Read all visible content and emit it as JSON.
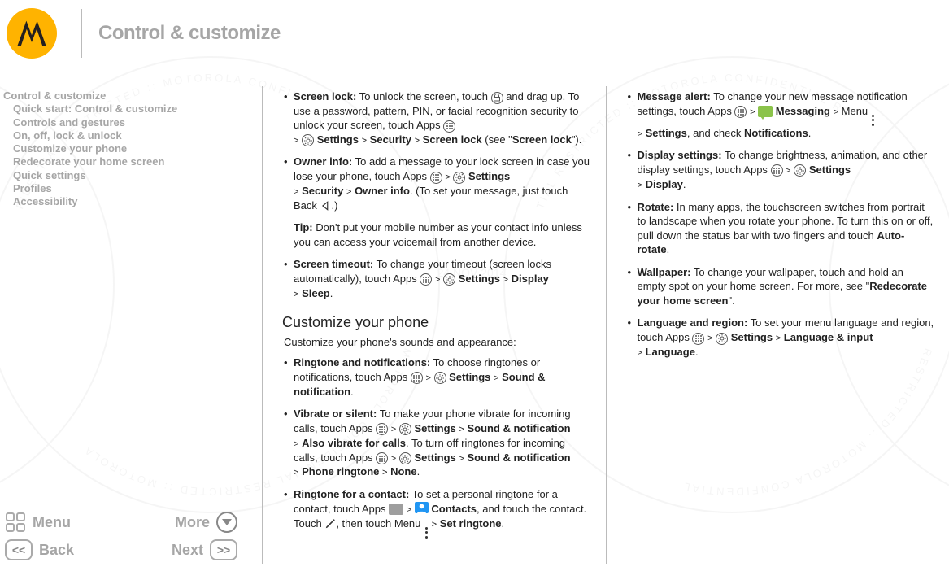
{
  "header": {
    "title": "Control & customize"
  },
  "toc": [
    {
      "label": "Control & customize",
      "lvl": 0
    },
    {
      "label": "Quick start: Control & customize",
      "lvl": 1
    },
    {
      "label": "Controls and gestures",
      "lvl": 1
    },
    {
      "label": "On, off, lock & unlock",
      "lvl": 1
    },
    {
      "label": "Customize your phone",
      "lvl": 1
    },
    {
      "label": "Redecorate your home screen",
      "lvl": 1
    },
    {
      "label": "Quick settings",
      "lvl": 1
    },
    {
      "label": "Profiles",
      "lvl": 1
    },
    {
      "label": "Accessibility",
      "lvl": 1
    }
  ],
  "nav": {
    "menu": "Menu",
    "more": "More",
    "back": "Back",
    "next": "Next"
  },
  "col1": {
    "screen_lock_b": "Screen lock:",
    "screen_lock_1": " To unlock the screen, touch ",
    "screen_lock_2": " and drag up. To use a password, pattern, PIN, or facial recognition security to unlock your screen, touch Apps ",
    "arrow": ">",
    "settings_b": "Settings",
    "security_b": "Security",
    "screenlock_b2": "Screen lock",
    "screen_lock_see": " (see \"",
    "screen_lock_link": "Screen lock",
    "screen_lock_end": "\").",
    "owner_b": "Owner info:",
    "owner_1": " To add a message to your lock screen in case you lose your phone, touch Apps ",
    "owner_info_b": "Owner info",
    "owner_2": ". (To set your message, just touch Back ",
    "owner_3": ".)",
    "tip_b": "Tip:",
    "tip_1": " Don't put your mobile number as your contact info unless you can access your voicemail from another device.",
    "timeout_b": "Screen timeout:",
    "timeout_1": " To change your timeout (screen locks automatically), touch Apps ",
    "display_b": "Display",
    "sleep_b": "Sleep",
    "h2": "Customize your phone",
    "intro": "Customize your phone's sounds and appearance:",
    "ring_b": "Ringtone and notifications:",
    "ring_1": " To choose ringtones or notifications, touch Apps ",
    "sound_b": "Sound & notification",
    "vibrate_b": "Vibrate or silent:",
    "vibrate_1": " To make your phone vibrate for incoming calls, touch Apps ",
    "also_vibrate_b": "Also vibrate for calls",
    "vibrate_2": ". To turn off ringtones for incoming calls, touch Apps ",
    "phone_ring_b": "Phone ringtone",
    "none_b": "None",
    "contact_b": "Ringtone for a contact:",
    "contact_1": " To set a personal ringtone for a contact, touch Apps ",
    "contacts_b2": "Contacts",
    "contact_2": ", and touch the contact. Touch ",
    "contact_3": ", then touch Menu ",
    "set_ring_b": "Set ringtone"
  },
  "col2": {
    "msg_b": "Message alert:",
    "msg_1": " To change your new message notification settings, touch Apps ",
    "messaging_b": "Messaging",
    "msg_2": " Menu ",
    "notifications_b": "Notifications",
    "check": ", and check ",
    "disp_b": "Display settings:",
    "disp_1": " To change brightness, animation, and other display settings, touch Apps ",
    "display_b": "Display",
    "rotate_b": "Rotate:",
    "rotate_1": " In many apps, the touchscreen switches from portrait to landscape when you rotate your phone. To turn this on or off, pull down the status bar with two fingers and touch ",
    "auto_rotate_b": "Auto-rotate",
    "wall_b": "Wallpaper:",
    "wall_1": " To change your wallpaper, touch and hold an empty spot on your home screen. For more, see \"",
    "redecorate_b": "Redecorate your home screen",
    "wall_2": "\".",
    "lang_b": "Language and region:",
    "lang_1": " To set your menu language and region, touch Apps ",
    "langinput_b": "Language & input",
    "language_b": "Language",
    "settings_b": "Settings",
    "arrow": ">"
  }
}
